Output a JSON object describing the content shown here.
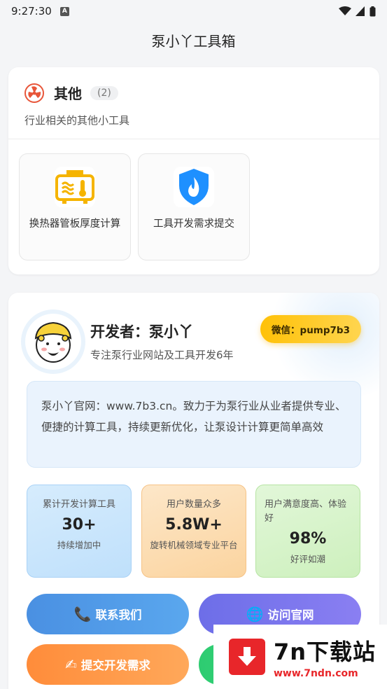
{
  "status_bar": {
    "time": "9:27:30",
    "badge": "A"
  },
  "app_bar": {
    "title": "泵小丫工具箱"
  },
  "other_section": {
    "title": "其他",
    "count": "(2)",
    "description": "行业相关的其他小工具",
    "tools": [
      {
        "label": "换热器管板厚度计算",
        "icon": "heat-exchanger-icon"
      },
      {
        "label": "工具开发需求提交",
        "icon": "shield-fire-icon"
      }
    ]
  },
  "developer": {
    "name": "开发者：泵小丫",
    "subtitle": "专注泵行业网站及工具开发6年",
    "wechat": "微信：pump7b3",
    "intro": "泵小丫官网：www.7b3.cn。致力于为泵行业从业者提供专业、便捷的计算工具，持续更新优化，让泵设计计算更简单高效"
  },
  "stats": [
    {
      "label": "累计开发计算工具",
      "value": "30+",
      "note": "持续增加中"
    },
    {
      "label": "用户数量众多",
      "value": "5.8W+",
      "note": "旋转机械领域专业平台"
    },
    {
      "label": "用户满意度高、体验好",
      "value": "98%",
      "note": "好评如潮"
    }
  ],
  "buttons": {
    "contact": "联系我们",
    "visit": "访问官网",
    "submit": "提交开发需求"
  },
  "watermark": {
    "title": "7n下载站",
    "url": "www.7ndn.com"
  },
  "colors": {
    "accent_blue": "#4a90e2",
    "accent_purple": "#6d6ee8",
    "accent_orange": "#ff8c3a",
    "accent_yellow": "#ffc107",
    "brand_red": "#e8262a"
  }
}
